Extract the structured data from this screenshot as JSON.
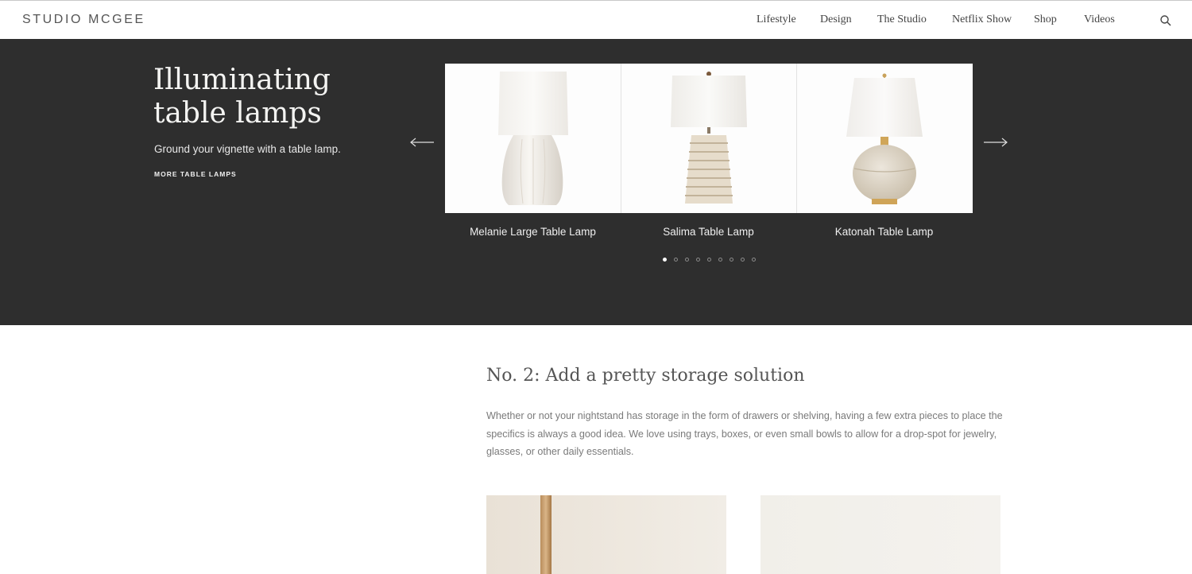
{
  "header": {
    "logo": "STUDIO MCGEE",
    "nav": [
      {
        "label": "Lifestyle"
      },
      {
        "label": "Design"
      },
      {
        "label": "The Studio"
      },
      {
        "label": "Netflix Show"
      },
      {
        "label": "Shop"
      },
      {
        "label": "Videos"
      }
    ],
    "search_icon": "search-icon"
  },
  "hero": {
    "title": "Illuminating table lamps",
    "subtitle": "Ground your vignette with a table lamp.",
    "link": "MORE TABLE LAMPS",
    "products": [
      {
        "name": "Melanie Large Table Lamp"
      },
      {
        "name": "Salima Table Lamp"
      },
      {
        "name": "Katonah Table Lamp"
      }
    ],
    "pagination": {
      "current": 1,
      "total": 9
    },
    "prev_icon": "arrow-left-icon",
    "next_icon": "arrow-right-icon"
  },
  "section": {
    "title": "No. 2: Add a pretty storage solution",
    "body": "Whether or not your nightstand has storage in the form of drawers or shelving, having a few extra pieces to place the specifics is always a good idea. We love using trays, boxes, or even small bowls to allow for a drop-spot for jewelry, glasses, or other daily essentials."
  },
  "colors": {
    "hero_background": "#2e2e2e",
    "page_background": "#ffffff"
  }
}
